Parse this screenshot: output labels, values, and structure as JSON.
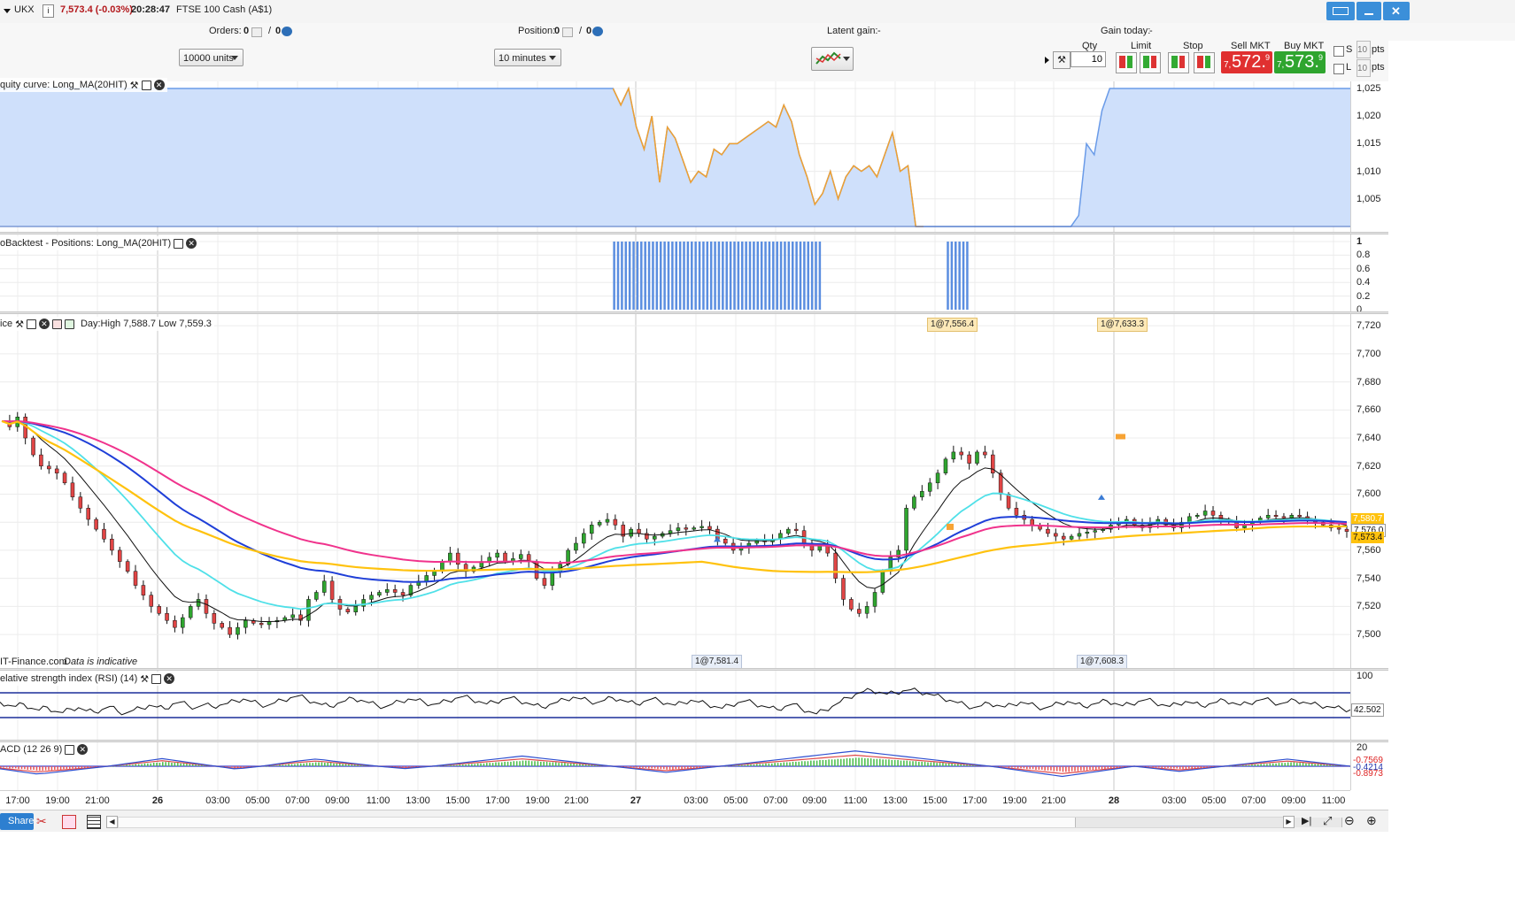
{
  "header": {
    "symbol": "UKX",
    "info_icon": "i",
    "price_change": "7,573.4 (-0.03%)",
    "time": "20:28:47",
    "instrument_name": "FTSE 100 Cash (A$1)"
  },
  "summary": {
    "orders_label": "Orders:",
    "orders_count": "0",
    "orders_sep": "/",
    "orders_count2": "0",
    "position_label": "Position:",
    "position_count": "0",
    "position_sep": "/",
    "position_count2": "0",
    "latent_label": "Latent gain:",
    "latent_value": "-",
    "gain_today_label": "Gain today:",
    "gain_today_value": "-"
  },
  "toolbar": {
    "units_select": "10000 units",
    "timeframe_select": "10 minutes",
    "qty_label": "Qty",
    "qty_value": "10",
    "limit_label": "Limit",
    "stop_label": "Stop",
    "sell_label": "Sell MKT",
    "sell_big": "572.",
    "sell_prefix": "7,",
    "sell_sup": "9",
    "buy_label": "Buy MKT",
    "buy_big": "573.",
    "buy_prefix": "7,",
    "buy_sup": "9",
    "s_label": "S",
    "l_label": "L",
    "s_value": "10",
    "l_value": "10",
    "pts1": "pts",
    "pts2": "pts",
    "colors": {
      "sell": "#e03030",
      "buy": "#2fa52f"
    }
  },
  "panes": {
    "equity_title": "quity curve: Long_MA(20HIT)",
    "positions_title": "oBacktest - Positions: Long_MA(20HIT)",
    "price_title": "ice",
    "price_dayinfo": "Day:High 7,588.7 Low 7,559.3",
    "watermark_left": "IT-Finance.com",
    "watermark_right": "Data is indicative",
    "rsi_title": "elative strength index (RSI) (14)",
    "macd_title": "ACD (12 26 9)"
  },
  "trade_tags": {
    "exit1": "1@7,556.4",
    "exit2": "1@7,633.3",
    "entry1": "1@7,581.4",
    "entry2": "1@7,608.3"
  },
  "price_boxes": {
    "box1": "7,580.7",
    "box2": "7,576.0",
    "box3": "7,573.4"
  },
  "rsi_boxes": {
    "value": "42.502"
  },
  "macd_boxes": {
    "v1": "-0.7569",
    "v2": "-0.4214",
    "v3": "-0.8973"
  },
  "bottom": {
    "share_label": "Share"
  },
  "chart_data": [
    {
      "type": "area",
      "title": "quity curve: Long_MA(20HIT)",
      "ylim": [
        1000,
        1025
      ],
      "yticks": [
        "1,025",
        "1,020",
        "1,015",
        "1,010",
        "1,005"
      ],
      "y": [
        1025,
        1025,
        1025,
        1025,
        1025,
        1025,
        1025,
        1025,
        1025,
        1025,
        1025,
        1025,
        1025,
        1025,
        1025,
        1025,
        1025,
        1025,
        1025,
        1025,
        1025,
        1025,
        1025,
        1025,
        1025,
        1025,
        1025,
        1025,
        1025,
        1025,
        1025,
        1025,
        1025,
        1025,
        1025,
        1025,
        1025,
        1025,
        1025,
        1025,
        1025,
        1025,
        1025,
        1025,
        1025,
        1025,
        1025,
        1025,
        1025,
        1025,
        1025,
        1025,
        1025,
        1025,
        1025,
        1025,
        1025,
        1025,
        1025,
        1025,
        1025,
        1025,
        1025,
        1025,
        1025,
        1025,
        1025,
        1025,
        1025,
        1025,
        1025,
        1025,
        1025,
        1025,
        1025,
        1025,
        1025,
        1025,
        1025,
        1025,
        1022,
        1025,
        1018,
        1014,
        1020,
        1008,
        1018,
        1016,
        1012,
        1008,
        1010,
        1009,
        1014,
        1013,
        1015,
        1015,
        1016,
        1017,
        1018,
        1019,
        1018,
        1022,
        1019,
        1013,
        1009,
        1004,
        1006,
        1010,
        1005,
        1009,
        1011,
        1010,
        1011,
        1009,
        1013,
        1017,
        1010,
        1011,
        1000,
        1000,
        1000,
        1000,
        1000,
        1000,
        1000,
        1000,
        1000,
        1000,
        1000,
        1000,
        1000,
        1000,
        1000,
        1000,
        1000,
        1000,
        1000,
        1000,
        1000,
        1002,
        1015,
        1013,
        1021,
        1025,
        1025,
        1025,
        1025,
        1025,
        1025,
        1025,
        1025,
        1025,
        1025,
        1025,
        1025,
        1025,
        1025,
        1025,
        1025,
        1025,
        1025,
        1025,
        1025,
        1025,
        1025,
        1025,
        1025,
        1025,
        1025,
        1025,
        1025,
        1025,
        1025,
        1025,
        1025
      ]
    },
    {
      "type": "bar",
      "title": "oBacktest - Positions: Long_MA(20HIT)",
      "ylim": [
        0,
        1
      ],
      "yticks": [
        "1",
        "0.8",
        "0.6",
        "0.4",
        "0.2",
        "0"
      ],
      "position_blocks": [
        {
          "start": 79,
          "end": 105,
          "value": 1
        },
        {
          "start": 122,
          "end": 124,
          "value": 1
        }
      ]
    },
    {
      "type": "line",
      "title": "ice",
      "xlabel": "",
      "ylabel": "",
      "ylim": [
        7490,
        7725
      ],
      "yticks": [
        "7,720",
        "7,700",
        "7,680",
        "7,660",
        "7,640",
        "7,620",
        "7,600",
        "7,580",
        "7,560",
        "7,540",
        "7,520",
        "7,500"
      ],
      "xticks": [
        "17:00",
        "19:00",
        "21:00",
        "26",
        "03:00",
        "05:00",
        "07:00",
        "09:00",
        "11:00",
        "13:00",
        "15:00",
        "17:00",
        "19:00",
        "21:00",
        "27",
        "03:00",
        "05:00",
        "07:00",
        "09:00",
        "11:00",
        "13:00",
        "15:00",
        "17:00",
        "19:00",
        "21:00",
        "28",
        "03:00",
        "05:00",
        "07:00",
        "09:00",
        "11:00"
      ],
      "close": [
        7652,
        7648,
        7655,
        7640,
        7628,
        7620,
        7618,
        7615,
        7608,
        7598,
        7590,
        7582,
        7575,
        7568,
        7560,
        7552,
        7545,
        7535,
        7528,
        7520,
        7515,
        7510,
        7505,
        7512,
        7520,
        7525,
        7515,
        7508,
        7505,
        7500,
        7505,
        7510,
        7508,
        7507,
        7509,
        7510,
        7512,
        7514,
        7510,
        7525,
        7530,
        7538,
        7525,
        7518,
        7516,
        7520,
        7525,
        7528,
        7530,
        7532,
        7530,
        7528,
        7535,
        7538,
        7542,
        7545,
        7552,
        7558,
        7550,
        7545,
        7548,
        7552,
        7555,
        7558,
        7552,
        7554,
        7557,
        7552,
        7540,
        7535,
        7545,
        7550,
        7560,
        7565,
        7572,
        7578,
        7580,
        7582,
        7578,
        7570,
        7575,
        7572,
        7568,
        7570,
        7572,
        7574,
        7576,
        7575,
        7576,
        7577,
        7575,
        7568,
        7565,
        7560,
        7562,
        7565,
        7567,
        7566,
        7568,
        7572,
        7575,
        7574,
        7565,
        7560,
        7563,
        7558,
        7540,
        7525,
        7518,
        7515,
        7520,
        7530,
        7545,
        7555,
        7560,
        7590,
        7598,
        7602,
        7608,
        7615,
        7625,
        7630,
        7628,
        7622,
        7630,
        7628,
        7615,
        7600,
        7590,
        7585,
        7582,
        7578,
        7575,
        7572,
        7570,
        7568,
        7570,
        7572,
        7573,
        7574,
        7575,
        7578,
        7580,
        7582,
        7578,
        7576,
        7580,
        7582,
        7578,
        7576,
        7580,
        7584,
        7585,
        7588,
        7585,
        7582,
        7580,
        7576,
        7578,
        7580,
        7583,
        7585,
        7584,
        7583,
        7585,
        7584,
        7582,
        7580,
        7578,
        7576,
        7575,
        7573.4
      ],
      "series": [
        {
          "name": "",
          "color": "#ffffff"
        },
        {
          "name": "",
          "color": "#4fe0e8"
        },
        {
          "name": "",
          "color": "#1f3fd8"
        },
        {
          "name": "",
          "color": "#f0338c"
        },
        {
          "name": "",
          "color": "#ffc20e"
        }
      ]
    },
    {
      "type": "line",
      "title": "elative strength index (RSI) (14)",
      "ylim": [
        0,
        100
      ],
      "yticks": [
        "100"
      ],
      "levels": [
        70,
        30
      ],
      "values": [
        55,
        50,
        48,
        52,
        45,
        42,
        47,
        40,
        38,
        44,
        46,
        41,
        39,
        43,
        48,
        40,
        37,
        42,
        45,
        50,
        47,
        44,
        52,
        55,
        49,
        46,
        51,
        48,
        50,
        53,
        57,
        60,
        56,
        52,
        49,
        54,
        58,
        62,
        65,
        60,
        55,
        51,
        48,
        53,
        57,
        61,
        58,
        54,
        50,
        47,
        52,
        56,
        60,
        58,
        55,
        51,
        53,
        57,
        61,
        64,
        60,
        56,
        52,
        55,
        59,
        62,
        58,
        54,
        50,
        47,
        51,
        55,
        59,
        63,
        60,
        57,
        54,
        58,
        62,
        59,
        55,
        52,
        56,
        60,
        57,
        53,
        50,
        54,
        58,
        55,
        52,
        48,
        45,
        50,
        54,
        57,
        53,
        49,
        46,
        43,
        48,
        52,
        45,
        40,
        36,
        42,
        48,
        55,
        62,
        68,
        72,
        74,
        71,
        68,
        70,
        73,
        75,
        72,
        69,
        66,
        62,
        58,
        54,
        50,
        46,
        49,
        53,
        50,
        47,
        51,
        55,
        52,
        48,
        45,
        49,
        53,
        56,
        52,
        48,
        51,
        54,
        57,
        53,
        49,
        52,
        56,
        59,
        55,
        51,
        48,
        52,
        56,
        53,
        49,
        52,
        55,
        58,
        54,
        50,
        53,
        57,
        60,
        56,
        52,
        55,
        58,
        55,
        52,
        50,
        48,
        46,
        44,
        42.502
      ]
    },
    {
      "type": "bar",
      "title": "ACD (12 26 9)",
      "ylim": [
        -20,
        20
      ],
      "yticks": [
        "20"
      ],
      "histogram": [
        -1,
        -1.5,
        -2,
        -2.5,
        -3,
        -2.8,
        -2.4,
        -2,
        -1.6,
        -1.2,
        -0.8,
        -0.4,
        0,
        0.5,
        1,
        1.5,
        2,
        2.5,
        3,
        2.5,
        2,
        1.5,
        1,
        0.5,
        0,
        -0.5,
        -1,
        -0.8,
        -0.4,
        0,
        0.5,
        1,
        1.5,
        2,
        2.4,
        2.8,
        2.5,
        2,
        1.6,
        1.2,
        0.8,
        0.4,
        0,
        -0.3,
        -0.6,
        -0.9,
        -0.6,
        -0.3,
        0,
        0.4,
        0.8,
        1.2,
        1.6,
        2,
        2.4,
        2.8,
        3.2,
        3.6,
        4,
        3.6,
        3.2,
        2.8,
        2.4,
        2,
        1.6,
        1.2,
        0.8,
        0.4,
        0,
        -0.4,
        -0.8,
        -1.2,
        -1.6,
        -2,
        -2.4,
        -2,
        -1.6,
        -1.2,
        -0.8,
        -0.4,
        0,
        0.4,
        0.8,
        1.2,
        1.6,
        2,
        2.4,
        2.8,
        3.2,
        3.6,
        4,
        4.4,
        4.8,
        5.2,
        5.6,
        6,
        5.6,
        5.2,
        4.8,
        4.4,
        4,
        3.6,
        3.2,
        2.8,
        2.4,
        2,
        1.6,
        1.2,
        0.8,
        0.4,
        0,
        -0.5,
        -1,
        -1.5,
        -2,
        -2.5,
        -3,
        -3.5,
        -4,
        -3.5,
        -3,
        -2.5,
        -2,
        -1.5,
        -1,
        -0.5,
        0,
        -0.4,
        -0.8,
        -1.2,
        -1.6,
        -2,
        -1.6,
        -1.2,
        -0.8,
        -0.4,
        0,
        0.4,
        0.8,
        1.2,
        1.6,
        2,
        2.4,
        2.8,
        2.4,
        2,
        1.6,
        1.2,
        0.8,
        0.4,
        0
      ]
    }
  ]
}
